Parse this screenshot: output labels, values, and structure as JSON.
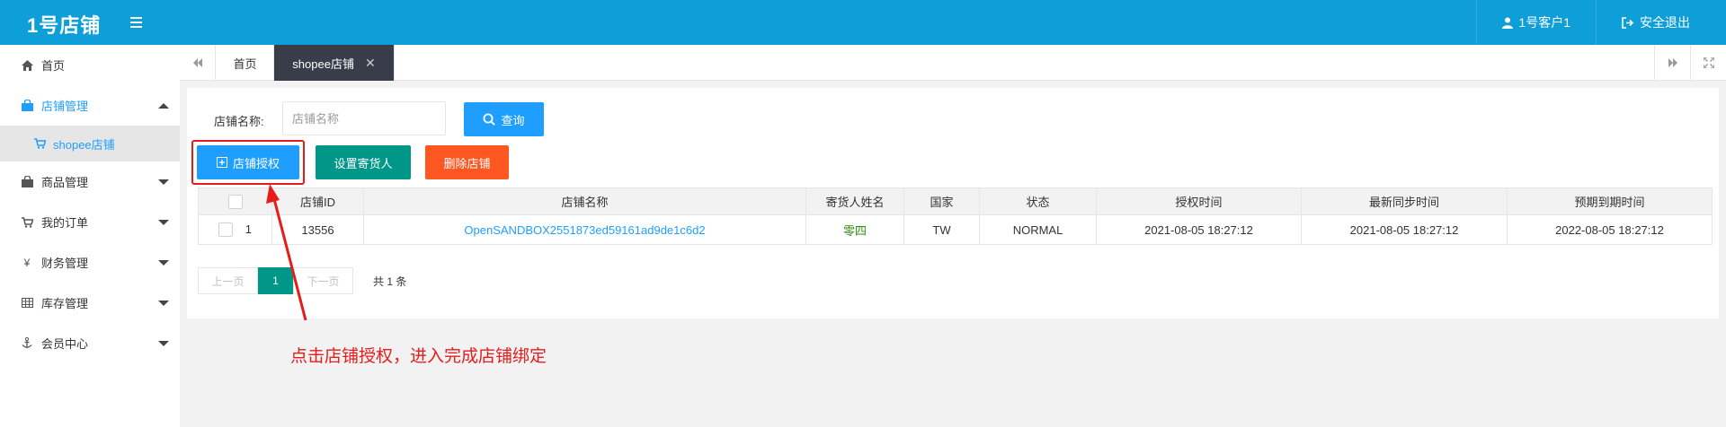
{
  "header": {
    "logo": "1号店铺",
    "user_label": "1号客户1",
    "logout_label": "安全退出"
  },
  "sidebar": {
    "items": [
      {
        "label": "首页",
        "icon": "home-icon"
      },
      {
        "label": "店铺管理",
        "icon": "shopping-bag-icon",
        "expanded": true
      },
      {
        "label": "shopee店铺",
        "icon": "cart-icon",
        "sub": true
      },
      {
        "label": "商品管理",
        "icon": "goods-icon"
      },
      {
        "label": "我的订单",
        "icon": "cart-icon"
      },
      {
        "label": "财务管理",
        "icon": "yen-icon"
      },
      {
        "label": "库存管理",
        "icon": "table-icon"
      },
      {
        "label": "会员中心",
        "icon": "anchor-icon"
      }
    ]
  },
  "tabs": {
    "home": "首页",
    "active": "shopee店铺",
    "close": "✕"
  },
  "search": {
    "label": "店铺名称:",
    "placeholder": "店铺名称",
    "button": "查询"
  },
  "toolbar": {
    "authorize": "店铺授权",
    "set_sender": "设置寄货人",
    "delete": "删除店铺"
  },
  "table": {
    "headers": [
      "店铺ID",
      "店铺名称",
      "寄货人姓名",
      "国家",
      "状态",
      "授权时间",
      "最新同步时间",
      "预期到期时间"
    ],
    "rows": [
      {
        "index": "1",
        "shop_id": "13556",
        "shop_name": "OpenSANDBOX2551873ed59161ad9de1c6d2",
        "sender": "零四",
        "country": "TW",
        "status": "NORMAL",
        "auth_time": "2021-08-05 18:27:12",
        "sync_time": "2021-08-05 18:27:12",
        "expire_time": "2022-08-05 18:27:12"
      }
    ]
  },
  "pager": {
    "prev": "上一页",
    "current": "1",
    "next": "下一页",
    "total": "共 1 条"
  },
  "annotation": {
    "text": "点击店铺授权，进入完成店铺绑定"
  },
  "colors": {
    "header": "#0e9ed8",
    "accent": "#1e9fff",
    "teal": "#009688",
    "orange": "#ff5722",
    "annotation_red": "#e81b1b",
    "active_tab": "#393d49"
  }
}
